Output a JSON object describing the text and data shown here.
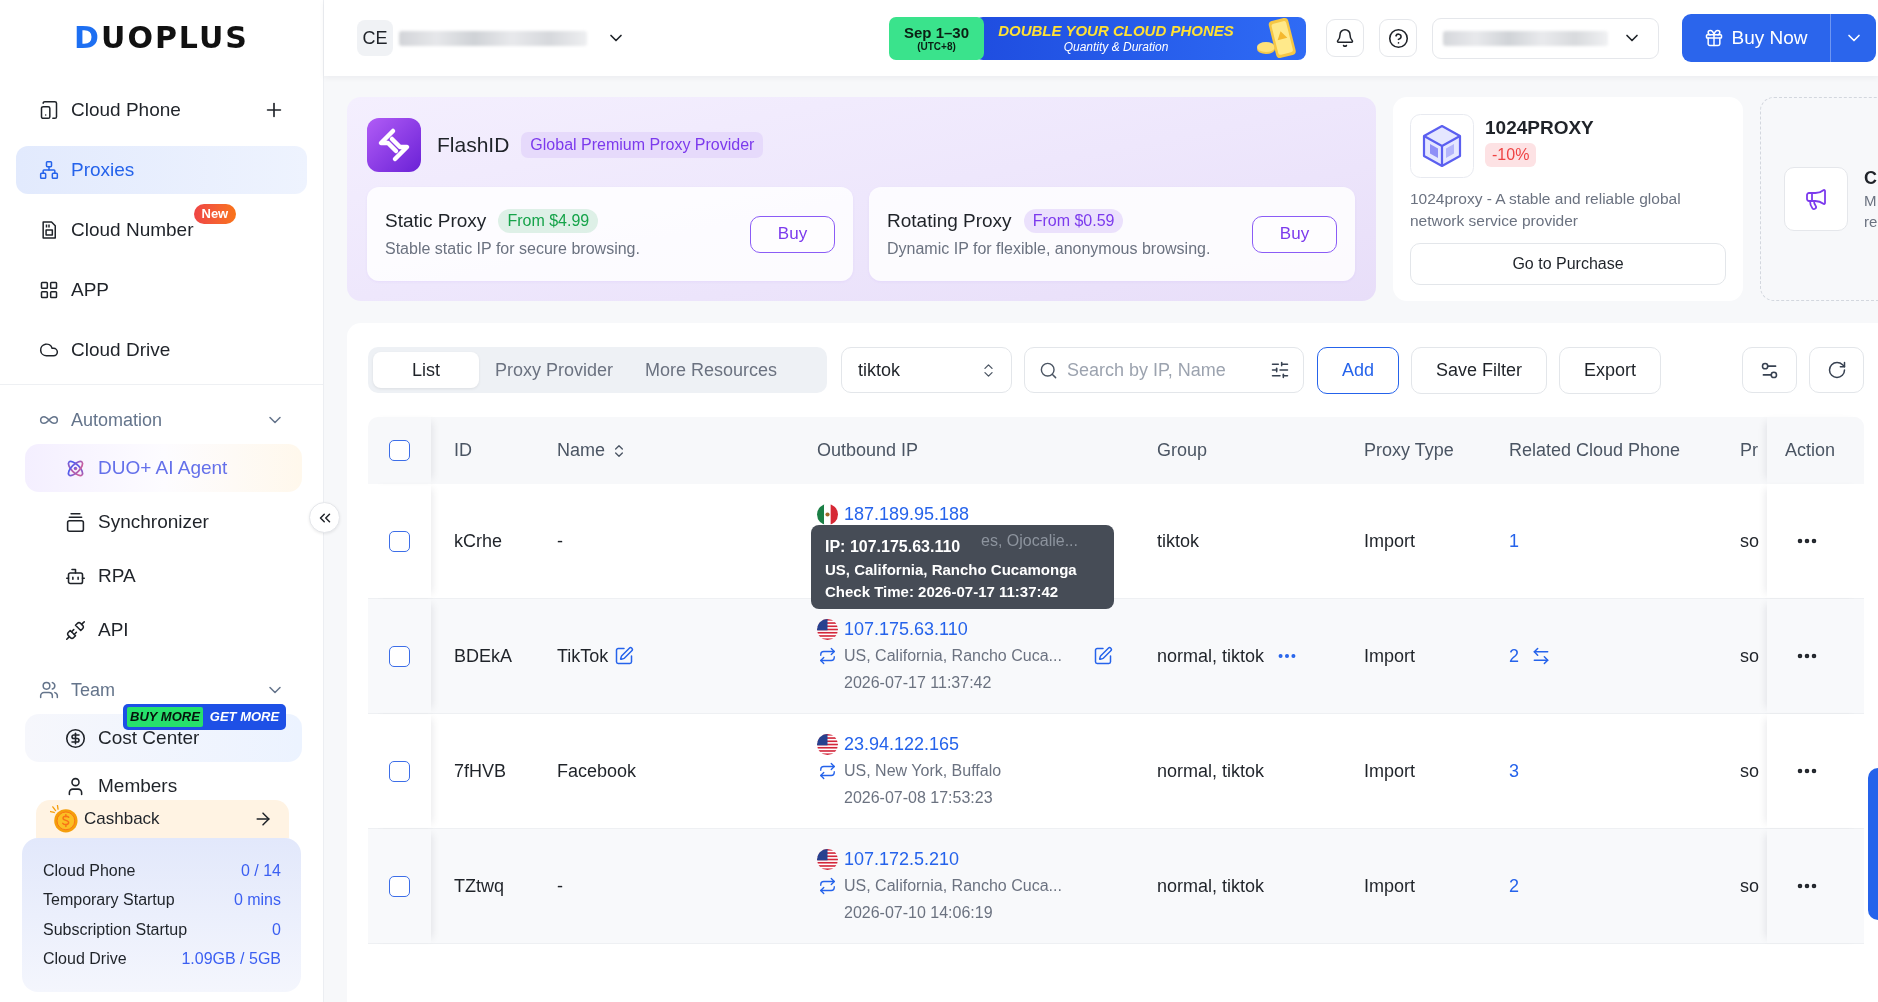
{
  "sidebar": {
    "logo": "DUOPLUS",
    "nav": [
      {
        "label": "Cloud Phone",
        "selected": false,
        "addable": true
      },
      {
        "label": "Proxies",
        "selected": true,
        "addable": false
      },
      {
        "label": "Cloud Number",
        "selected": false,
        "addable": false,
        "badge": "New"
      },
      {
        "label": "APP",
        "selected": false,
        "addable": false
      },
      {
        "label": "Cloud Drive",
        "selected": false,
        "addable": false
      }
    ],
    "groups": [
      {
        "label": "Automation",
        "expanded": true,
        "children": [
          {
            "label": "DUO+ AI Agent",
            "kind": "ai",
            "selected": false
          },
          {
            "label": "Synchronizer",
            "kind": "plain",
            "selected": false
          },
          {
            "label": "RPA",
            "kind": "plain",
            "selected": false
          },
          {
            "label": "API",
            "kind": "plain",
            "selected": false
          }
        ]
      },
      {
        "label": "Team",
        "expanded": true,
        "children": [
          {
            "label": "Cost Center",
            "kind": "promo",
            "selected": false,
            "promo_badge": [
              "BUY MORE",
              "GET MORE"
            ]
          },
          {
            "label": "Members",
            "kind": "plain",
            "selected": false
          }
        ]
      }
    ],
    "cashback": "Cashback",
    "usage": [
      {
        "label": "Cloud Phone",
        "value": "0 / 14"
      },
      {
        "label": "Temporary Startup",
        "value": "0 mins"
      },
      {
        "label": "Subscription Startup",
        "value": "0"
      },
      {
        "label": "Cloud Drive",
        "value": "1.09GB / 5GB"
      }
    ]
  },
  "topbar": {
    "workspace_avatar": "CE",
    "banner": {
      "date": "Sep 1–30",
      "timezone": "(UTC+8)",
      "headline": "DOUBLE YOUR CLOUD PHONES",
      "subline": "Quantity & Duration"
    },
    "buy_button": "Buy Now"
  },
  "promotions": {
    "featured": {
      "name": "FlashID",
      "tagline": "Global Premium Proxy Provider",
      "offers": [
        {
          "title": "Static Proxy",
          "price": "From $4.99",
          "color": "#16a34a",
          "description": "Stable static IP for secure browsing.",
          "button": "Buy"
        },
        {
          "title": "Rotating Proxy",
          "price": "From $0.59",
          "color": "#7c3aed",
          "description": "Dynamic IP for flexible, anonymous browsing.",
          "button": "Buy"
        }
      ]
    },
    "partner": {
      "name": "1024PROXY",
      "discount": "-10%",
      "description": "1024proxy - A stable and reliable global network service provider",
      "button": "Go to Purchase"
    },
    "next_card": {
      "title": "C",
      "lines": [
        "M",
        "re"
      ]
    }
  },
  "proxy_list": {
    "tabs": [
      {
        "label": "List",
        "selected": true
      },
      {
        "label": "Proxy Provider",
        "selected": false
      },
      {
        "label": "More Resources",
        "selected": false
      }
    ],
    "group_filter": "tiktok",
    "search": {
      "placeholder": "Search by IP, Name"
    },
    "buttons": [
      {
        "label": "Add",
        "kind": "primary"
      },
      {
        "label": "Save Filter",
        "kind": "default"
      },
      {
        "label": "Export",
        "kind": "default"
      }
    ],
    "all_checked": false,
    "columns": [
      {
        "label": "ID"
      },
      {
        "label": "Name",
        "sortable": true
      },
      {
        "label": "Outbound IP"
      },
      {
        "label": "Group"
      },
      {
        "label": "Proxy Type"
      },
      {
        "label": "Related Cloud Phone"
      },
      {
        "label": "Pr"
      },
      {
        "label": "Action"
      }
    ],
    "rows": [
      {
        "checked": false,
        "hovered": false,
        "id": "kCrhe",
        "name": "-",
        "flag": {
          "kind": "mexico"
        },
        "ip": "187.189.95.188",
        "location": "es, Ojocalie...",
        "partly_hidden": true,
        "group": "tiktok",
        "proxy_type": "Import",
        "related_phones": "1",
        "column_7": "so"
      },
      {
        "checked": false,
        "hovered": true,
        "id": "BDEkA",
        "name": "TikTok",
        "flag": {
          "kind": "usa"
        },
        "ip": "107.175.63.110",
        "ip_tooltip": {
          "title": "IP: 107.175.63.110",
          "location": "US, California, Rancho Cucamonga",
          "check_time": "Check Time: 2026-07-17 11:37:42"
        },
        "location": "US, California, Rancho Cuca...",
        "partly_hidden": false,
        "checked_at": "2026-07-17 11:37:42",
        "group": "normal, tiktok",
        "proxy_type": "Import",
        "related_phones": "2",
        "column_7": "so"
      },
      {
        "checked": false,
        "hovered": false,
        "id": "7fHVB",
        "name": "Facebook",
        "flag": {
          "kind": "usa"
        },
        "ip": "23.94.122.165",
        "location": "US, New York, Buffalo",
        "partly_hidden": false,
        "checked_at": "2026-07-08 17:53:23",
        "group": "normal, tiktok",
        "proxy_type": "Import",
        "related_phones": "3",
        "column_7": "so"
      },
      {
        "checked": false,
        "hovered": false,
        "id": "TZtwq",
        "name": "-",
        "flag": {
          "kind": "usa"
        },
        "ip": "107.172.5.210",
        "location": "US, California, Rancho Cuca...",
        "partly_hidden": false,
        "checked_at": "2026-07-10 14:06:19",
        "group": "normal, tiktok",
        "proxy_type": "Import",
        "related_phones": "2",
        "column_7": "so"
      }
    ]
  }
}
